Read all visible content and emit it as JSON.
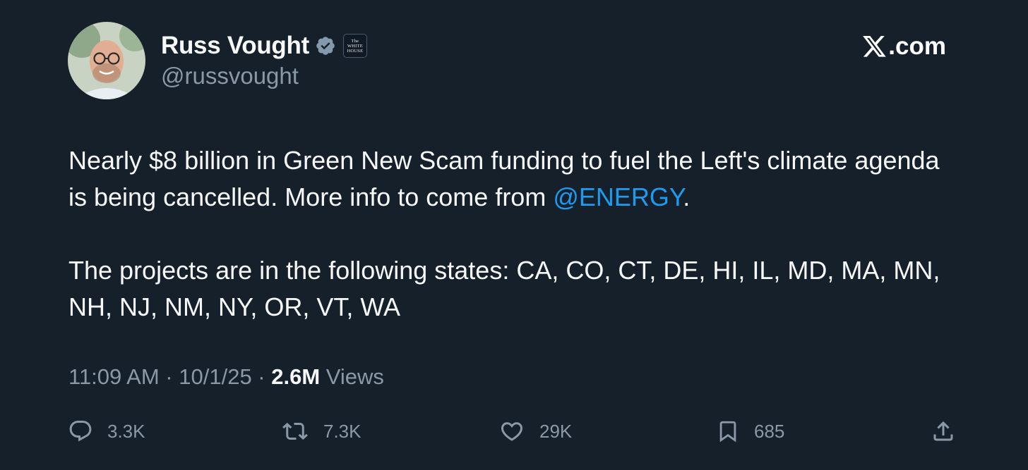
{
  "author": {
    "display_name": "Russ Vought",
    "handle": "@russvought",
    "verified_icon": "verified-badge-icon",
    "affiliation_label": "The\nWHITE\nHOUSE",
    "avatar_icon": "profile-photo"
  },
  "source": {
    "logo_icon": "x-logo-icon",
    "label": ".com"
  },
  "tweet": {
    "para1_before": "Nearly $8 billion in Green New Scam funding to fuel the Left's climate agenda is being cancelled. More info to come from ",
    "para1_mention": "@ENERGY",
    "para1_after": ".",
    "para2": "The projects are in the following states: CA, CO, CT, DE, HI, IL, MD, MA, MN, NH, NJ, NM, NY, OR, VT, WA"
  },
  "meta": {
    "time": "11:09 AM",
    "sep1": " · ",
    "date": "10/1/25",
    "sep2": " · ",
    "views_count": "2.6M",
    "views_label": " Views"
  },
  "actions": {
    "reply": {
      "icon": "reply-icon",
      "count": "3.3K"
    },
    "repost": {
      "icon": "repost-icon",
      "count": "7.3K"
    },
    "like": {
      "icon": "heart-icon",
      "count": "29K"
    },
    "bookmark": {
      "icon": "bookmark-icon",
      "count": "685"
    },
    "share": {
      "icon": "share-icon"
    }
  },
  "colors": {
    "background": "#15202b",
    "text": "#f7f9f9",
    "secondary": "#8b98a5",
    "link": "#1d9bf0",
    "verified": "#829aab"
  }
}
